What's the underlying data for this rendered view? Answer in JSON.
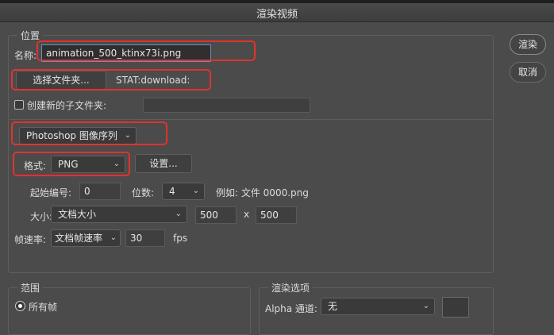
{
  "dialog": {
    "title": "渲染视频"
  },
  "actions": {
    "render_label": "渲染",
    "cancel_label": "取消"
  },
  "location": {
    "legend": "位置",
    "name_label": "名称:",
    "name_value": "animation_500_ktinx73i.png",
    "choose_folder_label": "选择文件夹...",
    "folder_path": "STAT:download:",
    "create_subfolder_label": "创建新的子文件夹:",
    "subfolder_value": ""
  },
  "export": {
    "type_value": "Photoshop 图像序列",
    "format_label": "格式:",
    "format_value": "PNG",
    "settings_label": "设置...",
    "start_number_label": "起始编号:",
    "start_number_value": "0",
    "digits_label": "位数:",
    "digits_value": "4",
    "example_text": "例如: 文件 0000.png",
    "size_label": "大小:",
    "size_value": "文档大小",
    "width_value": "500",
    "x_label": "x",
    "height_value": "500",
    "fps_label": "帧速率:",
    "fps_select_value": "文档帧速率",
    "fps_value": "30",
    "fps_unit": "fps"
  },
  "range": {
    "legend": "范围",
    "all_frames_label": "所有帧"
  },
  "render_options": {
    "legend": "渲染选项",
    "alpha_label": "Alpha 通道:",
    "alpha_value": "无"
  },
  "colors": {
    "highlight": "#e2322d",
    "background": "#4b4b4b"
  }
}
